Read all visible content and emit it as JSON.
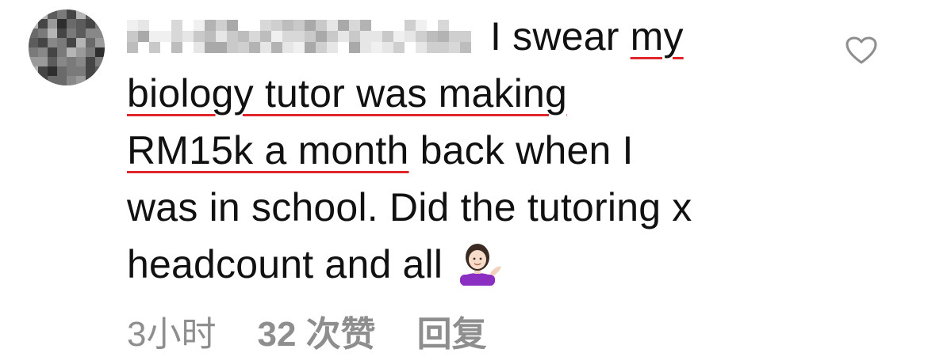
{
  "comment": {
    "author_name": "",
    "lines": [
      {
        "before": "I swear ",
        "highlight": "my",
        "after": ""
      },
      {
        "before": "",
        "highlight": "biology tutor was making",
        "after": ""
      },
      {
        "before": "",
        "highlight": "RM15k a month",
        "after": " back when I"
      },
      {
        "before": "was in school. Did the tutoring x",
        "highlight": "",
        "after": ""
      },
      {
        "before": "headcount and all",
        "highlight": "",
        "after": ""
      }
    ],
    "emoji": "person-tipping-hand-emoji",
    "underline_color": "#e0252b"
  },
  "meta": {
    "time": "3小时",
    "likes": "32 次赞",
    "reply": "回复",
    "text_color": "#8e8e8e"
  },
  "icons": {
    "like": "heart-outline-icon"
  }
}
